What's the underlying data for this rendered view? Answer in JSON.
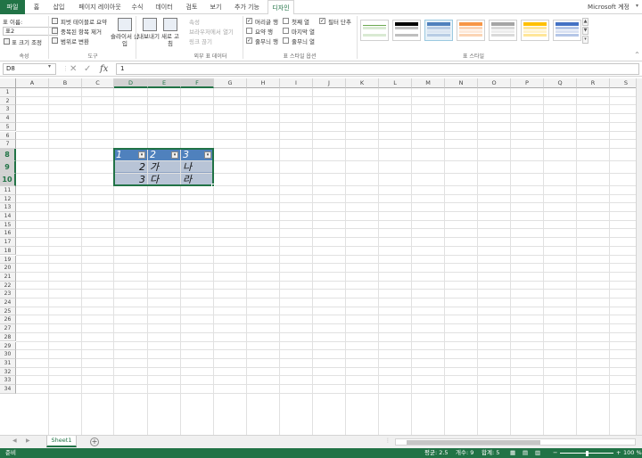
{
  "tabs": {
    "file": "파일",
    "home": "홈",
    "insert": "삽입",
    "layout": "페이지 레이아웃",
    "formulas": "수식",
    "data": "데이터",
    "review": "검토",
    "view": "보기",
    "addins": "추가 기능",
    "design": "디자인",
    "account": "Microsoft 계정"
  },
  "ribbon": {
    "props": {
      "name_label": "표 이름:",
      "name_value": "표2",
      "resize": "표 크기 조정",
      "group": "속성"
    },
    "tools": {
      "pivot": "피벗 테이블로 요약",
      "dedupe": "중복된 항목 제거",
      "convert": "범위로 변환",
      "slicer": "슬라이서 삽입",
      "group": "도구"
    },
    "external": {
      "export": "내보내기",
      "refresh": "새로 고침",
      "props": "속성",
      "open_browser": "브라우저에서 열기",
      "unlink": "링크 끊기",
      "group": "외부 표 데이터"
    },
    "styleopts": {
      "header_row": "머리글 행",
      "total_row": "요약 행",
      "banded_rows": "줄무늬 행",
      "first_col": "첫째 열",
      "last_col": "마지막 열",
      "banded_cols": "줄무늬 열",
      "filter_btn": "필터 단추",
      "group": "표 스타일 옵션"
    },
    "styles": {
      "group": "표 스타일"
    }
  },
  "formula": {
    "namebox": "D8",
    "content": "1"
  },
  "columns": [
    "A",
    "B",
    "C",
    "D",
    "E",
    "F",
    "G",
    "H",
    "I",
    "J",
    "K",
    "L",
    "M",
    "N",
    "O",
    "P",
    "Q",
    "R",
    "S"
  ],
  "rows": [
    "1",
    "2",
    "3",
    "4",
    "5",
    "6",
    "7",
    "8",
    "9",
    "10",
    "11",
    "12",
    "13",
    "14",
    "15",
    "16",
    "17",
    "18",
    "19",
    "20",
    "21",
    "22",
    "23",
    "24",
    "25",
    "26",
    "27",
    "28",
    "29",
    "30",
    "31",
    "32",
    "33",
    "34"
  ],
  "table": {
    "header": [
      "1",
      "2",
      "3"
    ],
    "rows": [
      [
        "2",
        "가",
        "나"
      ],
      [
        "3",
        "다",
        "라"
      ]
    ]
  },
  "sheet": {
    "name": "Sheet1"
  },
  "status": {
    "ready": "준비",
    "average": "평균: 2.5",
    "count": "개수: 9",
    "sum": "합계: 5",
    "zoom": "100 %"
  },
  "colors": {
    "excel_green": "#217346",
    "table_header": "#4f81bd",
    "table_band": "#b8c4d6"
  }
}
